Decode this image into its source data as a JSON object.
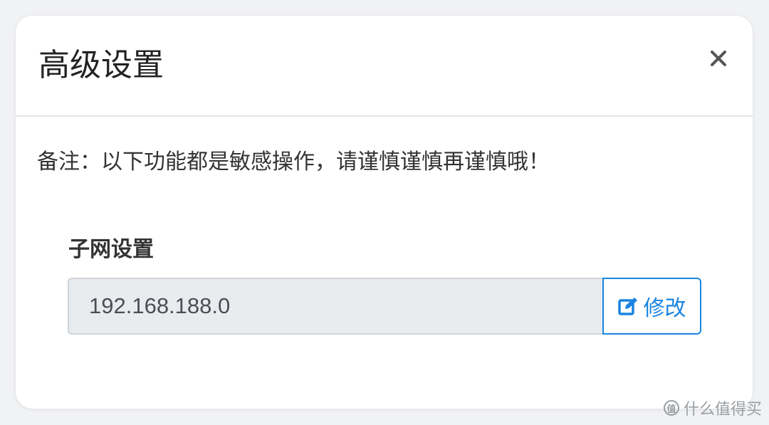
{
  "dialog": {
    "title": "高级设置",
    "close_icon": "close-icon"
  },
  "note": "备注：以下功能都是敏感操作，请谨慎谨慎再谨慎哦！",
  "subnet": {
    "label": "子网设置",
    "value": "192.168.188.0",
    "edit_label": "修改",
    "edit_icon": "edit-icon"
  },
  "watermark": {
    "text": "什么值得买",
    "icon_glyph": "值"
  },
  "colors": {
    "accent": "#1a84e0",
    "input_bg": "#e9ecef",
    "page_bg": "#f1f2f4"
  }
}
